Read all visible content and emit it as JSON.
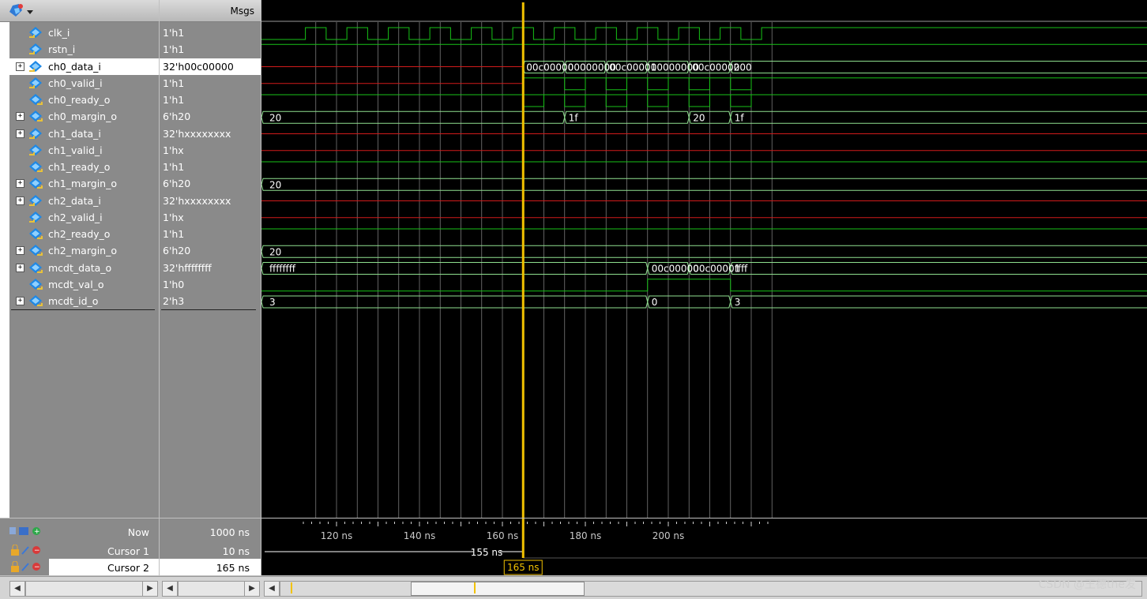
{
  "toolbar": {
    "msgs_label": "Msgs"
  },
  "signals": [
    {
      "name": "clk_i",
      "value": "1'h1",
      "icon": "input-icon",
      "expandable": false,
      "selected": false
    },
    {
      "name": "rstn_i",
      "value": "1'h1",
      "icon": "input-icon",
      "expandable": false,
      "selected": false
    },
    {
      "name": "ch0_data_i",
      "value": "32'h00c00000",
      "icon": "input-icon",
      "expandable": true,
      "selected": true
    },
    {
      "name": "ch0_valid_i",
      "value": "1'h1",
      "icon": "input-icon",
      "expandable": false,
      "selected": false
    },
    {
      "name": "ch0_ready_o",
      "value": "1'h1",
      "icon": "output-icon",
      "expandable": false,
      "selected": false
    },
    {
      "name": "ch0_margin_o",
      "value": "6'h20",
      "icon": "output-icon",
      "expandable": true,
      "selected": false
    },
    {
      "name": "ch1_data_i",
      "value": "32'hxxxxxxxx",
      "icon": "input-icon",
      "expandable": true,
      "selected": false
    },
    {
      "name": "ch1_valid_i",
      "value": "1'hx",
      "icon": "input-icon",
      "expandable": false,
      "selected": false
    },
    {
      "name": "ch1_ready_o",
      "value": "1'h1",
      "icon": "output-icon",
      "expandable": false,
      "selected": false
    },
    {
      "name": "ch1_margin_o",
      "value": "6'h20",
      "icon": "output-icon",
      "expandable": true,
      "selected": false
    },
    {
      "name": "ch2_data_i",
      "value": "32'hxxxxxxxx",
      "icon": "input-icon",
      "expandable": true,
      "selected": false
    },
    {
      "name": "ch2_valid_i",
      "value": "1'hx",
      "icon": "input-icon",
      "expandable": false,
      "selected": false
    },
    {
      "name": "ch2_ready_o",
      "value": "1'h1",
      "icon": "output-icon",
      "expandable": false,
      "selected": false
    },
    {
      "name": "ch2_margin_o",
      "value": "6'h20",
      "icon": "output-icon",
      "expandable": true,
      "selected": false
    },
    {
      "name": "mcdt_data_o",
      "value": "32'hffffffff",
      "icon": "output-icon",
      "expandable": true,
      "selected": false
    },
    {
      "name": "mcdt_val_o",
      "value": "1'h0",
      "icon": "output-icon",
      "expandable": false,
      "selected": false
    },
    {
      "name": "mcdt_id_o",
      "value": "2'h3",
      "icon": "output-icon",
      "expandable": true,
      "selected": false
    }
  ],
  "wave_labels": {
    "ch0_data_i": [
      "00c00000",
      "00000000",
      "00c00001",
      "00000000",
      "00c00002",
      "000"
    ],
    "ch0_margin_o": [
      "20",
      "1f",
      "20",
      "1f"
    ],
    "ch1_margin_o": [
      "20"
    ],
    "ch2_margin_o": [
      "20"
    ],
    "mcdt_data_o": [
      "ffffffff",
      "00c00000",
      "00c00001",
      "ffff"
    ],
    "mcdt_id_o": [
      "3",
      "0",
      "3"
    ]
  },
  "footer": {
    "now_label": "Now",
    "now_value": "1000 ns",
    "cursor1_label": "Cursor 1",
    "cursor1_value": "10 ns",
    "cursor2_label": "Cursor 2",
    "cursor2_value": "165 ns",
    "delta_label": "155 ns",
    "cursor_flag": "165 ns"
  },
  "timeline_ticks": [
    "120 ns",
    "140 ns",
    "160 ns",
    "180 ns",
    "200 ns"
  ],
  "colors": {
    "wave_green": "#17c217",
    "wave_red": "#d11b1b",
    "cursor_yellow": "#f2c200",
    "bus_outline": "#8fe08f"
  },
  "watermark": "CSDN @王德the发"
}
